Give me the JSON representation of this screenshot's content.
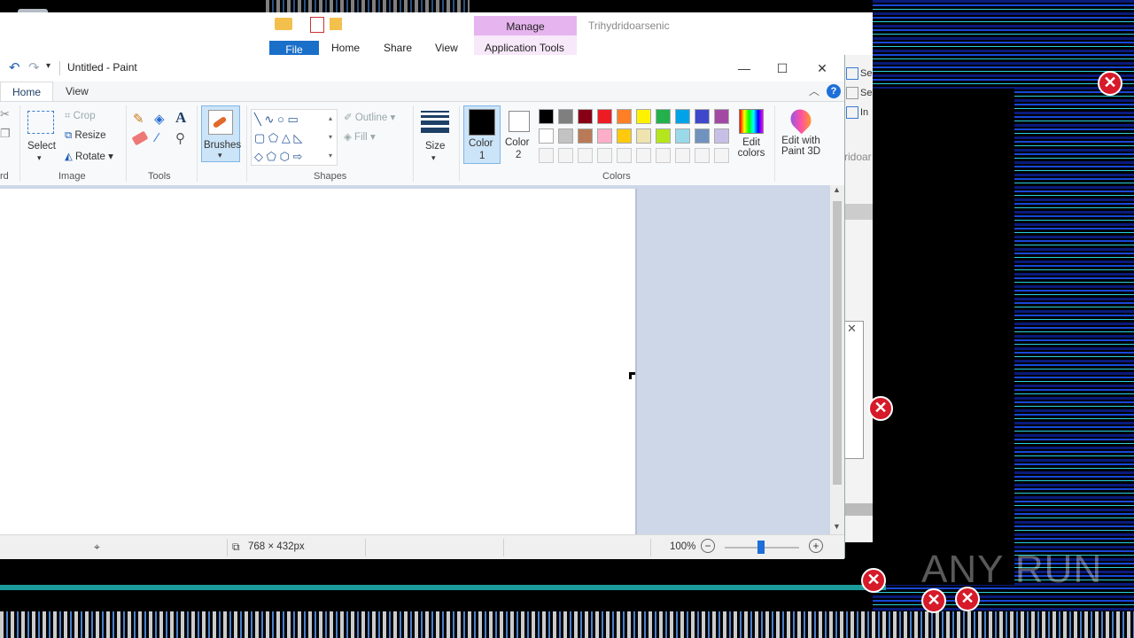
{
  "explorer": {
    "title": "Trihydridoarsenic",
    "tabs": {
      "file": "File",
      "home": "Home",
      "share": "Share",
      "view": "View",
      "manage": "Manage",
      "app_tools": "Application Tools"
    },
    "side_items": [
      "Se",
      "Se",
      "In"
    ],
    "search_fragment": "ridoar"
  },
  "paint": {
    "window_title": "Untitled - Paint",
    "tabs": {
      "home": "Home",
      "view": "View"
    },
    "image_group": {
      "select": "Select",
      "crop": "Crop",
      "resize": "Resize",
      "rotate": "Rotate",
      "label": "Image"
    },
    "tools_group": {
      "label": "Tools"
    },
    "brushes": "Brushes",
    "shapes_group": {
      "outline": "Outline",
      "fill": "Fill",
      "label": "Shapes"
    },
    "size": "Size",
    "colors_group": {
      "color1": "Color",
      "color1_num": "1",
      "color2": "Color",
      "color2_num": "2",
      "edit_colors_1": "Edit",
      "edit_colors_2": "colors",
      "edit_3d_1": "Edit with",
      "edit_3d_2": "Paint 3D",
      "label": "Colors",
      "row1": [
        "#000000",
        "#7f7f7f",
        "#880015",
        "#ed1c24",
        "#ff7f27",
        "#fff200",
        "#22b14c",
        "#00a2e8",
        "#3f48cc",
        "#a349a4"
      ],
      "row2": [
        "#ffffff",
        "#c3c3c3",
        "#b97a57",
        "#ffaec9",
        "#ffc90e",
        "#efe4b0",
        "#b5e61d",
        "#99d9ea",
        "#7092be",
        "#c8bfe7"
      ]
    },
    "clipboard_fragment": "rd",
    "status": {
      "dimensions": "768 × 432px",
      "zoom": "100%"
    }
  },
  "watermark": "ANY RUN"
}
